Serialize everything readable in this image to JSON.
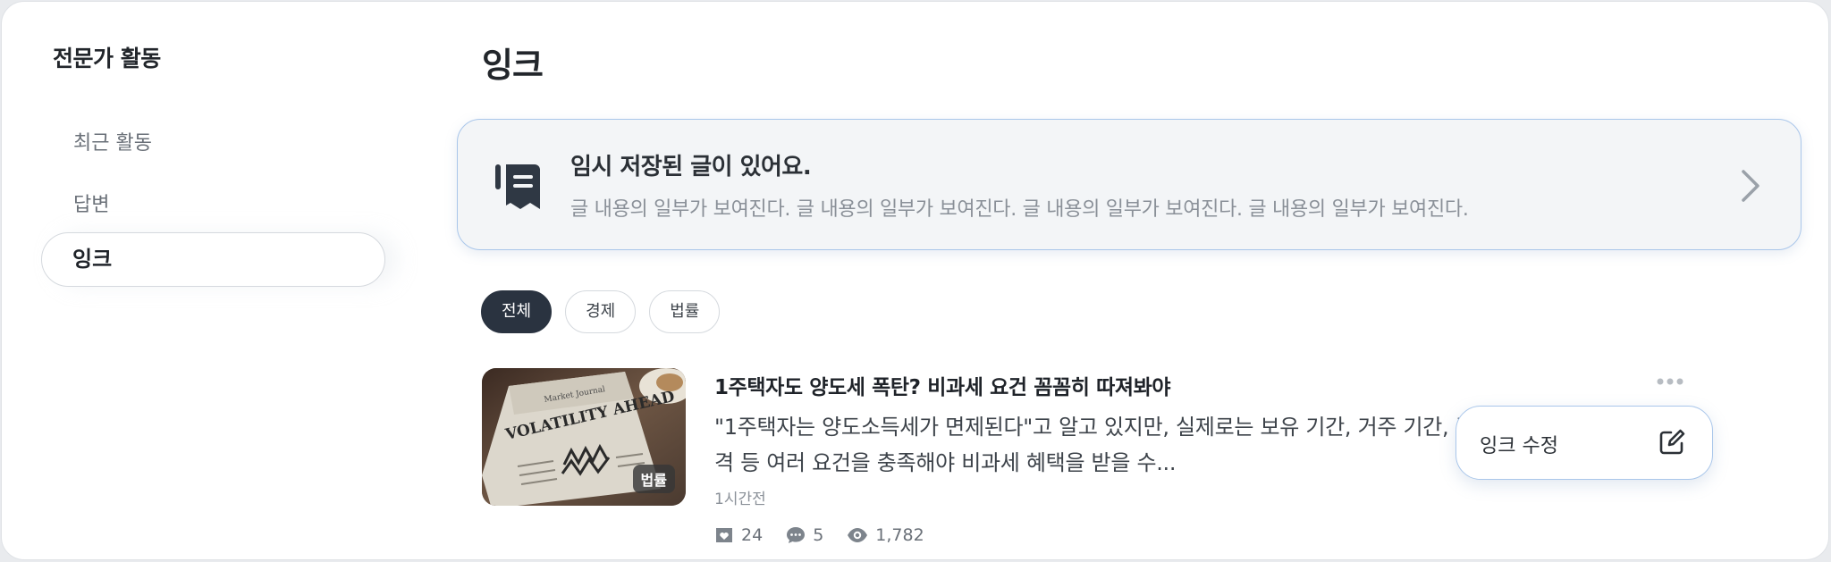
{
  "sidebar": {
    "title": "전문가 활동",
    "items": [
      {
        "label": "최근 활동"
      },
      {
        "label": "답변"
      },
      {
        "label": "잉크"
      }
    ]
  },
  "main": {
    "title": "잉크",
    "draft": {
      "title": "임시 저장된 글이 있어요.",
      "description": "글 내용의 일부가 보여진다. 글 내용의 일부가 보여진다. 글 내용의 일부가 보여진다. 글 내용의 일부가 보여진다.",
      "icon": "draft-document-icon"
    },
    "filters": [
      "전체",
      "경제",
      "법률"
    ],
    "active_filter": "전체",
    "post": {
      "badge": "법률",
      "title": "1주택자도 양도세 폭탄? 비과세 요건 꼼꼼히 따져봐야",
      "body": "\"1주택자는 양도소득세가 면제된다\"고 알고 있지만, 실제로는 보유 기간, 거주 기간, 주택 가격 등 여러 요건을 충족해야 비과세 혜택을 받을 수...",
      "time": "1시간전",
      "likes": "24",
      "comments": "5",
      "views": "1,782",
      "thumb_text": "Market Journal",
      "thumb_headline": "VOLATILITY AHEAD"
    },
    "context_menu": {
      "label": "잉크 수정"
    }
  },
  "colors": {
    "accent_border": "#a9c6ea",
    "active_chip": "#2a3340",
    "card_bg": "#f3f5f7"
  }
}
